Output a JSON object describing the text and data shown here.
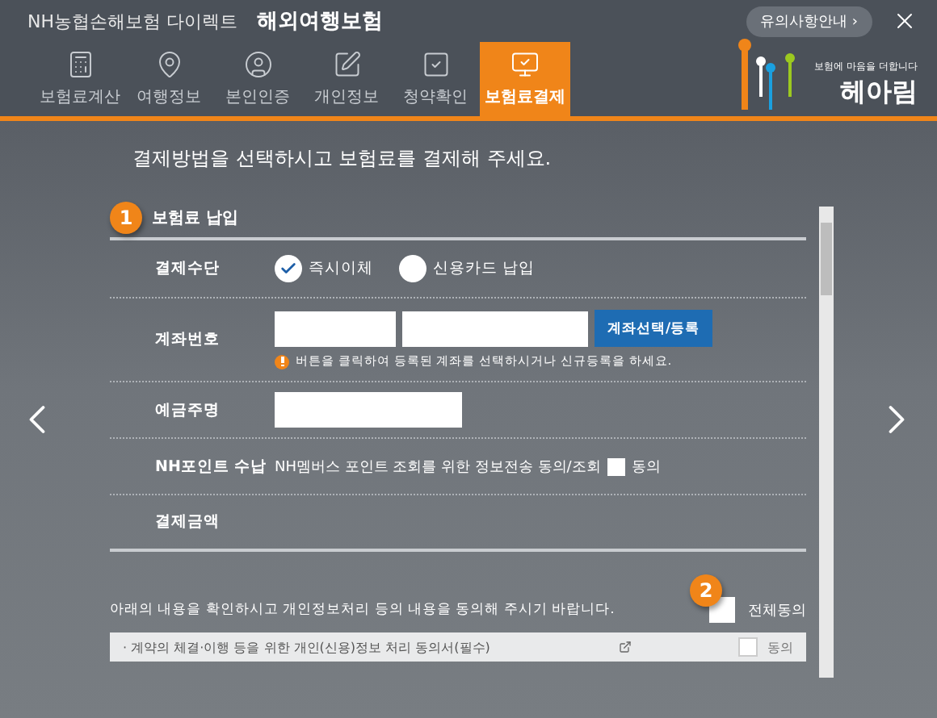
{
  "header": {
    "brand": "NH농협손해보험 다이렉트",
    "title": "해외여행보험",
    "notice_button": "유의사항안내 ›"
  },
  "nav": {
    "tabs": [
      {
        "label": "보험료계산",
        "selected": false
      },
      {
        "label": "여행정보",
        "selected": false
      },
      {
        "label": "본인인증",
        "selected": false
      },
      {
        "label": "개인정보",
        "selected": false
      },
      {
        "label": "청약확인",
        "selected": false
      },
      {
        "label": "보험료결제",
        "selected": true
      }
    ]
  },
  "logo": {
    "tagline": "보험에 마음을 더합니다",
    "name": "헤아림"
  },
  "intro": "결제방법을 선택하시고 보험료를 결제해 주세요.",
  "section": {
    "number": "1",
    "title": "보험료 납입",
    "rows": [
      {
        "kind": "radio",
        "label": "결제수단",
        "options": [
          {
            "label": "즉시이체",
            "selected": true
          },
          {
            "label": "신용카드 납입",
            "selected": false
          }
        ]
      },
      {
        "kind": "account",
        "label": "계좌번호",
        "button": "계좌선택/등록",
        "hint": "버튼을 클릭하여 등록된 계좌를 선택하시거나 신규등록을 하세요."
      },
      {
        "kind": "input",
        "label": "예금주명"
      },
      {
        "kind": "checkbox",
        "label": "NH포인트 수납",
        "text": "NH멤버스 포인트 조회를 위한 정보전송 동의/조회",
        "checkbox_label": "동의",
        "checked": false
      },
      {
        "kind": "empty",
        "label": "결제금액"
      }
    ]
  },
  "agreement": {
    "text": "아래의 내용을 확인하시고 개인정보처리 등의 내용을 동의해 주시기 바랍니다.",
    "number": "2",
    "all_label": "전체동의",
    "all_checked": false,
    "items": [
      {
        "text": "· 계약의 체결·이행 등을 위한 개인(신용)정보 처리 동의서(필수)",
        "checkbox_label": "동의",
        "checked": false
      }
    ]
  }
}
